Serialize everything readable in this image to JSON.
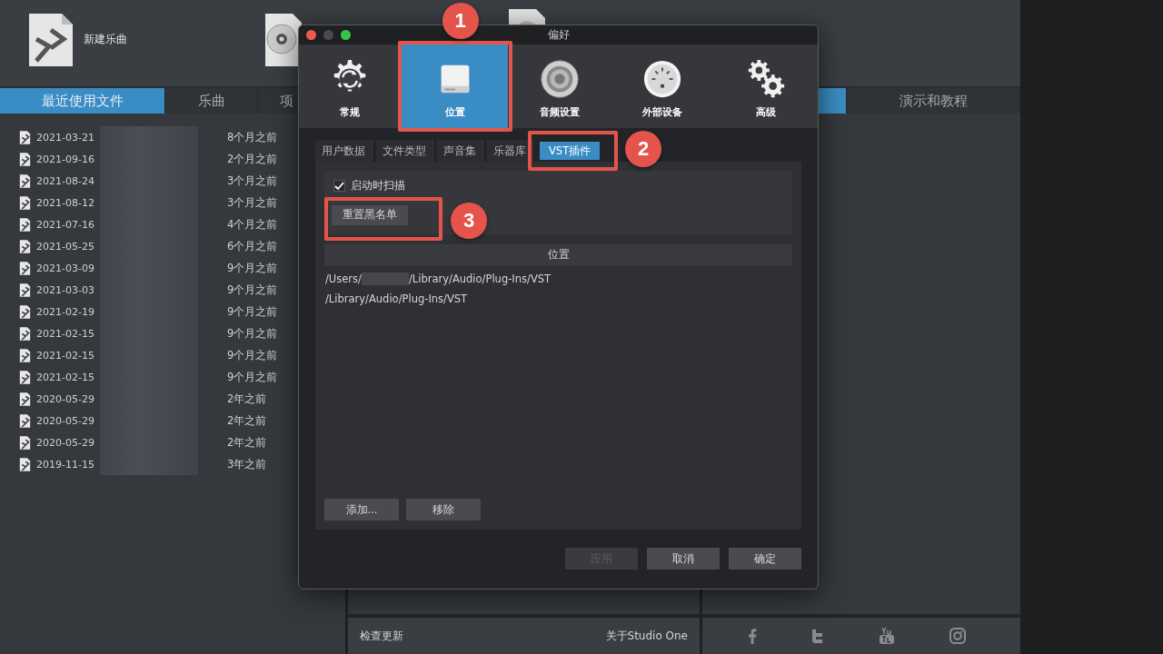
{
  "toolbar": {
    "new_song_label": "新建乐曲"
  },
  "tabs_left": [
    {
      "label": "最近使用文件",
      "selected": true
    },
    {
      "label": "乐曲",
      "selected": false
    },
    {
      "label": "项",
      "selected": false
    }
  ],
  "tabs_right": [
    {
      "selected": true
    },
    {
      "label": "演示和教程",
      "selected": false
    }
  ],
  "recent_files": [
    {
      "date": "2021-03-21",
      "name_redacted": true,
      "age": "8个月之前"
    },
    {
      "date": "2021-09-16",
      "name_redacted": true,
      "age": "2个月之前"
    },
    {
      "date": "2021-08-24",
      "name_redacted": true,
      "age": "3个月之前"
    },
    {
      "date": "2021-08-12",
      "name_redacted": true,
      "age": "3个月之前"
    },
    {
      "date": "2021-07-16",
      "name_redacted": true,
      "age": "4个月之前"
    },
    {
      "date": "2021-05-25",
      "name_redacted": true,
      "age": "6个月之前"
    },
    {
      "date": "2021-03-09",
      "name_redacted": true,
      "age": "9个月之前"
    },
    {
      "date": "2021-03-03",
      "name_redacted": true,
      "age": "9个月之前"
    },
    {
      "date": "2021-02-19",
      "name_redacted": true,
      "age": "9个月之前"
    },
    {
      "date": "2021-02-15",
      "name_redacted": true,
      "age": "9个月之前"
    },
    {
      "date": "2021-02-15",
      "name_redacted": true,
      "age": "9个月之前"
    },
    {
      "date": "2021-02-15",
      "name_redacted": true,
      "age": "9个月之前"
    },
    {
      "date": "2020-05-29",
      "name_redacted": true,
      "age": "2年之前"
    },
    {
      "date": "2020-05-29",
      "name_redacted": true,
      "age": "2年之前"
    },
    {
      "date": "2020-05-29",
      "name_redacted": true,
      "age": "2年之前"
    },
    {
      "date": "2019-11-15",
      "name_redacted": true,
      "age": "3年之前"
    }
  ],
  "bottom_bar": {
    "check_updates": "检查更新",
    "about": "关于Studio One"
  },
  "dialog": {
    "title": "偏好",
    "sections": [
      {
        "kind": "general",
        "label": "常规",
        "selected": false
      },
      {
        "kind": "locations",
        "label": "位置",
        "selected": true,
        "callout": "1"
      },
      {
        "kind": "audio",
        "label": "音频设置",
        "selected": false
      },
      {
        "kind": "devices",
        "label": "外部设备",
        "selected": false
      },
      {
        "kind": "advanced",
        "label": "高级",
        "selected": false
      }
    ],
    "tabs": [
      {
        "label": "用户数据",
        "selected": false
      },
      {
        "label": "文件类型",
        "selected": false
      },
      {
        "label": "声音集",
        "selected": false
      },
      {
        "label": "乐器库",
        "selected": false
      },
      {
        "label": "VST插件",
        "selected": true,
        "callout": "2"
      }
    ],
    "scan_on_startup": {
      "label": "启动时扫描",
      "checked": true
    },
    "reset_blacklist": {
      "label": "重置黑名单",
      "callout": "3"
    },
    "locations_header": "位置",
    "locations": [
      {
        "before": "/Users/",
        "redacted": true,
        "after": "/Library/Audio/Plug-Ins/VST"
      },
      {
        "before": "/Library/Audio/Plug-Ins/VST",
        "redacted": false
      }
    ],
    "list_buttons": [
      "添加...",
      "移除"
    ],
    "footer_buttons": [
      {
        "label": "应用",
        "disabled": true
      },
      {
        "label": "取消",
        "disabled": false
      },
      {
        "label": "确定",
        "disabled": false
      }
    ]
  }
}
